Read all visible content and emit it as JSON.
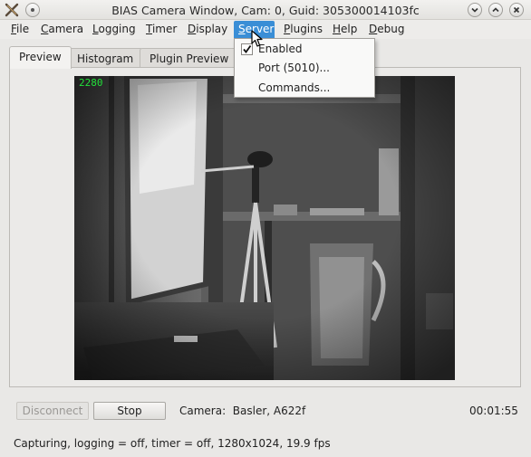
{
  "window": {
    "title": "BIAS Camera Window, Cam: 0, Guid: 305300014103fc"
  },
  "menubar": {
    "items": [
      {
        "label": "File",
        "mnemonic": "F",
        "rest": "ile"
      },
      {
        "label": "Camera",
        "mnemonic": "C",
        "rest": "amera"
      },
      {
        "label": "Logging",
        "mnemonic": "L",
        "rest": "ogging"
      },
      {
        "label": "Timer",
        "mnemonic": "T",
        "rest": "imer"
      },
      {
        "label": "Display",
        "mnemonic": "D",
        "rest": "isplay"
      },
      {
        "label": "Server",
        "mnemonic": "S",
        "rest": "erver"
      },
      {
        "label": "Plugins",
        "mnemonic": "P",
        "rest": "lugins"
      },
      {
        "label": "Help",
        "mnemonic": "H",
        "rest": "elp"
      },
      {
        "label": "Debug",
        "mnemonic": "D",
        "rest": "ebug"
      }
    ],
    "active": "Server"
  },
  "server_menu": {
    "items": [
      {
        "label": "Enabled",
        "checked": true
      },
      {
        "label": "Port (5010)..."
      },
      {
        "label": "Commands..."
      }
    ]
  },
  "tabs": [
    {
      "label": "Preview",
      "selected": true
    },
    {
      "label": "Histogram"
    },
    {
      "label": "Plugin Preview"
    }
  ],
  "preview": {
    "frame_counter": "2280"
  },
  "controls": {
    "disconnect_label": "Disconnect",
    "stop_label": "Stop",
    "camera_prefix": "Camera:",
    "camera_value": "Basler,  A622f",
    "elapsed": "00:01:55"
  },
  "status": {
    "text": "Capturing, logging = off, timer = off, 1280x1024,  19.9 fps"
  },
  "colors": {
    "menu_highlight": "#3a8ed6",
    "frame_counter": "#22e03a"
  }
}
